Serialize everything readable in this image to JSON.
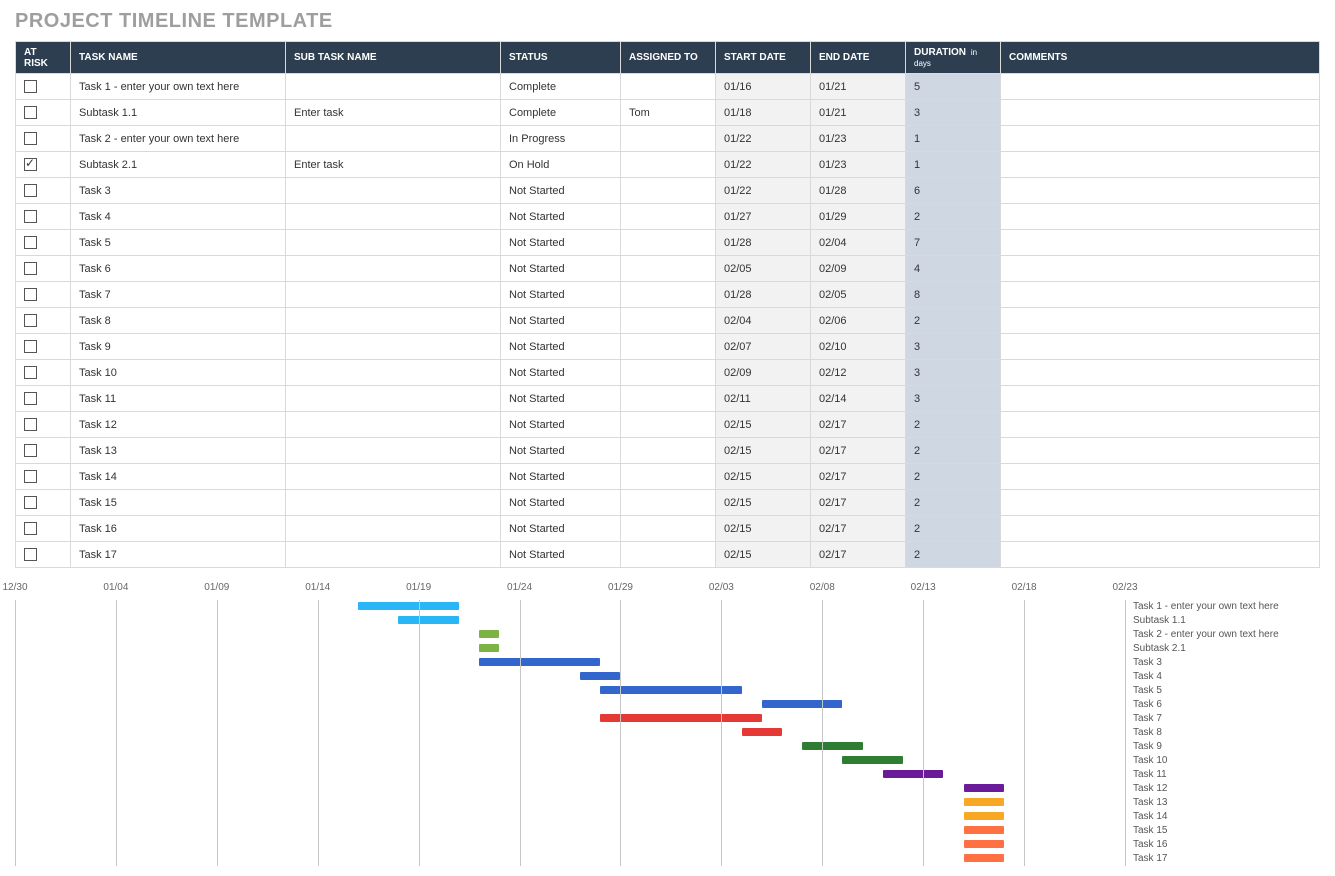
{
  "title": "PROJECT TIMELINE TEMPLATE",
  "headers": {
    "risk": "AT RISK",
    "task": "TASK NAME",
    "sub": "SUB TASK NAME",
    "status": "STATUS",
    "assigned": "ASSIGNED TO",
    "start": "START DATE",
    "end": "END DATE",
    "duration": "DURATION",
    "duration_unit": "in days",
    "comments": "COMMENTS"
  },
  "rows": [
    {
      "risk": false,
      "task": "Task 1 - enter your own text here",
      "sub": "",
      "status": "Complete",
      "assigned": "",
      "start": "01/16",
      "end": "01/21",
      "dur": "5",
      "comm": ""
    },
    {
      "risk": false,
      "task": "Subtask 1.1",
      "sub": "Enter task",
      "status": "Complete",
      "assigned": "Tom",
      "start": "01/18",
      "end": "01/21",
      "dur": "3",
      "comm": ""
    },
    {
      "risk": false,
      "task": "Task 2 - enter your own text here",
      "sub": "",
      "status": "In Progress",
      "assigned": "",
      "start": "01/22",
      "end": "01/23",
      "dur": "1",
      "comm": ""
    },
    {
      "risk": true,
      "task": "Subtask 2.1",
      "sub": "Enter task",
      "status": "On Hold",
      "assigned": "",
      "start": "01/22",
      "end": "01/23",
      "dur": "1",
      "comm": ""
    },
    {
      "risk": false,
      "task": "Task 3",
      "sub": "",
      "status": "Not Started",
      "assigned": "",
      "start": "01/22",
      "end": "01/28",
      "dur": "6",
      "comm": ""
    },
    {
      "risk": false,
      "task": "Task 4",
      "sub": "",
      "status": "Not Started",
      "assigned": "",
      "start": "01/27",
      "end": "01/29",
      "dur": "2",
      "comm": ""
    },
    {
      "risk": false,
      "task": "Task 5",
      "sub": "",
      "status": "Not Started",
      "assigned": "",
      "start": "01/28",
      "end": "02/04",
      "dur": "7",
      "comm": ""
    },
    {
      "risk": false,
      "task": "Task 6",
      "sub": "",
      "status": "Not Started",
      "assigned": "",
      "start": "02/05",
      "end": "02/09",
      "dur": "4",
      "comm": ""
    },
    {
      "risk": false,
      "task": "Task 7",
      "sub": "",
      "status": "Not Started",
      "assigned": "",
      "start": "01/28",
      "end": "02/05",
      "dur": "8",
      "comm": ""
    },
    {
      "risk": false,
      "task": "Task 8",
      "sub": "",
      "status": "Not Started",
      "assigned": "",
      "start": "02/04",
      "end": "02/06",
      "dur": "2",
      "comm": ""
    },
    {
      "risk": false,
      "task": "Task 9",
      "sub": "",
      "status": "Not Started",
      "assigned": "",
      "start": "02/07",
      "end": "02/10",
      "dur": "3",
      "comm": ""
    },
    {
      "risk": false,
      "task": "Task 10",
      "sub": "",
      "status": "Not Started",
      "assigned": "",
      "start": "02/09",
      "end": "02/12",
      "dur": "3",
      "comm": ""
    },
    {
      "risk": false,
      "task": "Task 11",
      "sub": "",
      "status": "Not Started",
      "assigned": "",
      "start": "02/11",
      "end": "02/14",
      "dur": "3",
      "comm": ""
    },
    {
      "risk": false,
      "task": "Task 12",
      "sub": "",
      "status": "Not Started",
      "assigned": "",
      "start": "02/15",
      "end": "02/17",
      "dur": "2",
      "comm": ""
    },
    {
      "risk": false,
      "task": "Task 13",
      "sub": "",
      "status": "Not Started",
      "assigned": "",
      "start": "02/15",
      "end": "02/17",
      "dur": "2",
      "comm": ""
    },
    {
      "risk": false,
      "task": "Task 14",
      "sub": "",
      "status": "Not Started",
      "assigned": "",
      "start": "02/15",
      "end": "02/17",
      "dur": "2",
      "comm": ""
    },
    {
      "risk": false,
      "task": "Task 15",
      "sub": "",
      "status": "Not Started",
      "assigned": "",
      "start": "02/15",
      "end": "02/17",
      "dur": "2",
      "comm": ""
    },
    {
      "risk": false,
      "task": "Task 16",
      "sub": "",
      "status": "Not Started",
      "assigned": "",
      "start": "02/15",
      "end": "02/17",
      "dur": "2",
      "comm": ""
    },
    {
      "risk": false,
      "task": "Task 17",
      "sub": "",
      "status": "Not Started",
      "assigned": "",
      "start": "02/15",
      "end": "02/17",
      "dur": "2",
      "comm": ""
    }
  ],
  "chart_data": {
    "type": "bar",
    "orientation": "horizontal-gantt",
    "x_axis_ticks": [
      "12/30",
      "01/04",
      "01/09",
      "01/14",
      "01/19",
      "01/24",
      "01/29",
      "02/03",
      "02/08",
      "02/13",
      "02/18",
      "02/23"
    ],
    "x_start": "12/30",
    "x_end": "02/23",
    "colors": [
      "#29b6f6",
      "#29b6f6",
      "#7cb342",
      "#7cb342",
      "#3366cc",
      "#3366cc",
      "#3366cc",
      "#3366cc",
      "#e53935",
      "#e53935",
      "#2e7d32",
      "#2e7d32",
      "#6a1b9a",
      "#6a1b9a",
      "#f9a825",
      "#f9a825",
      "#ff7043",
      "#ff7043",
      "#ff7043"
    ],
    "series": [
      {
        "name": "Task 1 - enter your own text here",
        "start": "01/16",
        "end": "01/21",
        "color": "#29b6f6"
      },
      {
        "name": "Subtask 1.1",
        "start": "01/18",
        "end": "01/21",
        "color": "#29b6f6"
      },
      {
        "name": "Task 2 - enter your own text here",
        "start": "01/22",
        "end": "01/23",
        "color": "#7cb342"
      },
      {
        "name": "Subtask 2.1",
        "start": "01/22",
        "end": "01/23",
        "color": "#7cb342"
      },
      {
        "name": "Task 3",
        "start": "01/22",
        "end": "01/28",
        "color": "#3366cc"
      },
      {
        "name": "Task 4",
        "start": "01/27",
        "end": "01/29",
        "color": "#3366cc"
      },
      {
        "name": "Task 5",
        "start": "01/28",
        "end": "02/04",
        "color": "#3366cc"
      },
      {
        "name": "Task 6",
        "start": "02/05",
        "end": "02/09",
        "color": "#3366cc"
      },
      {
        "name": "Task 7",
        "start": "01/28",
        "end": "02/05",
        "color": "#e53935"
      },
      {
        "name": "Task 8",
        "start": "02/04",
        "end": "02/06",
        "color": "#e53935"
      },
      {
        "name": "Task 9",
        "start": "02/07",
        "end": "02/10",
        "color": "#2e7d32"
      },
      {
        "name": "Task 10",
        "start": "02/09",
        "end": "02/12",
        "color": "#2e7d32"
      },
      {
        "name": "Task 11",
        "start": "02/11",
        "end": "02/14",
        "color": "#6a1b9a"
      },
      {
        "name": "Task 12",
        "start": "02/15",
        "end": "02/17",
        "color": "#6a1b9a"
      },
      {
        "name": "Task 13",
        "start": "02/15",
        "end": "02/17",
        "color": "#f9a825"
      },
      {
        "name": "Task 14",
        "start": "02/15",
        "end": "02/17",
        "color": "#f9a825"
      },
      {
        "name": "Task 15",
        "start": "02/15",
        "end": "02/17",
        "color": "#ff7043"
      },
      {
        "name": "Task 16",
        "start": "02/15",
        "end": "02/17",
        "color": "#ff7043"
      },
      {
        "name": "Task 17",
        "start": "02/15",
        "end": "02/17",
        "color": "#ff7043"
      }
    ]
  }
}
